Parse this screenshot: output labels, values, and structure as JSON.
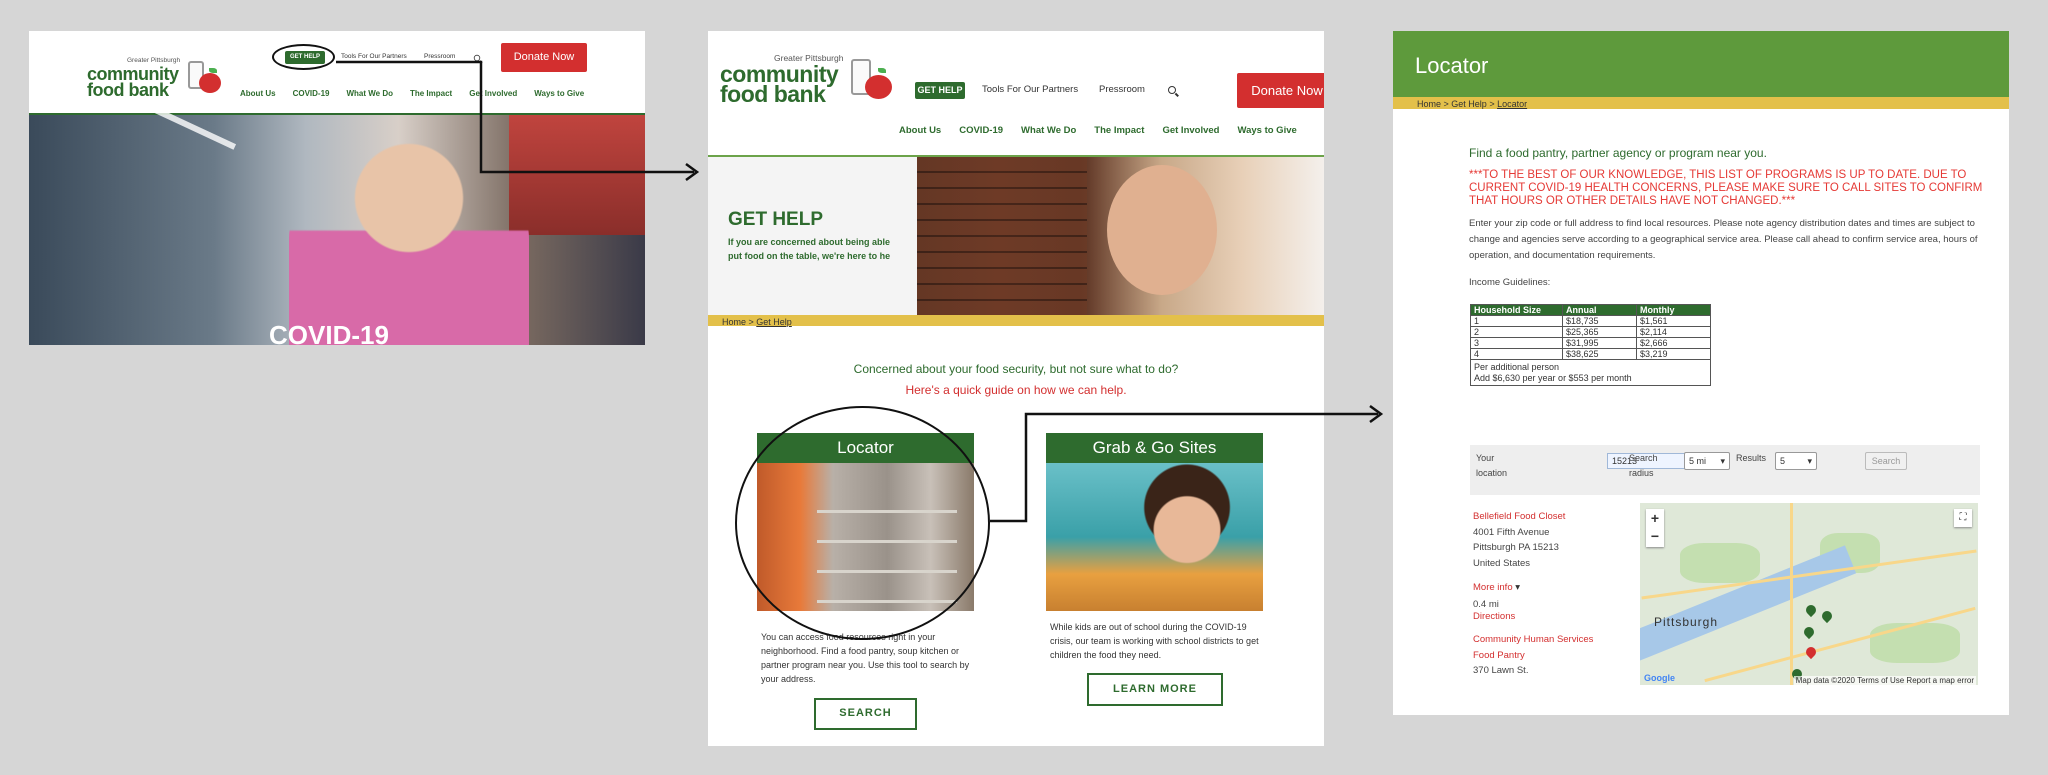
{
  "site": {
    "logo_pre": "Greater Pittsburgh",
    "logo_line1": "community",
    "logo_line2": "food bank",
    "get_help": "GET HELP",
    "tools": "Tools For Our Partners",
    "pressroom": "Pressroom",
    "donate": "Donate Now",
    "nav": [
      "About Us",
      "COVID-19",
      "What We Do",
      "The Impact",
      "Get Involved",
      "Ways to Give"
    ]
  },
  "panel1": {
    "hero_caption": "COVID-19"
  },
  "panel2": {
    "title": "GET HELP",
    "subtitle_1": "If you are concerned about being able",
    "subtitle_2": "put food on the table, we're here to he",
    "crumb_home": "Home",
    "crumb_sep": " > ",
    "crumb_current": "Get Help",
    "question": "Concerned about your food security, but not sure what to do?",
    "guide": "Here's a quick guide on how we can help.",
    "card1": {
      "title": "Locator",
      "text": "You can access food resources right in your neighborhood. Find a food pantry, soup kitchen or partner program near you. Use this tool to search by your address.",
      "button": "SEARCH"
    },
    "card2": {
      "title": "Grab & Go Sites",
      "text": "While kids are out of school during the COVID-19 crisis, our team is working with school districts to get children the food they need.",
      "button": "LEARN MORE"
    }
  },
  "panel3": {
    "title": "Locator",
    "crumb_home": "Home",
    "crumb_gethelp": "Get Help",
    "crumb_current": "Locator",
    "heading": "Find a food pantry, partner agency or program near you.",
    "warning": "***TO THE BEST OF OUR KNOWLEDGE, THIS LIST OF PROGRAMS IS UP TO DATE. DUE TO CURRENT COVID-19 HEALTH CONCERNS, PLEASE MAKE SURE TO CALL SITES TO CONFIRM THAT HOURS OR OTHER DETAILS HAVE NOT CHANGED.***",
    "intro": "Enter your zip code or full address to find local resources. Please note agency distribution dates and times are subject to change and agencies serve according to a geographical service area. Please call ahead to confirm service area, hours of operation, and documentation requirements.",
    "income_label": "Income Guidelines:",
    "table_headers": [
      "Household Size",
      "Annual",
      "Monthly"
    ],
    "table_rows": [
      [
        "1",
        "$18,735",
        "$1,561"
      ],
      [
        "2",
        "$25,365",
        "$2,114"
      ],
      [
        "3",
        "$31,995",
        "$2,666"
      ],
      [
        "4",
        "$38,625",
        "$3,219"
      ]
    ],
    "table_extra_1": "Per additional person",
    "table_extra_2": "Add $6,630 per year or $553 per month",
    "search": {
      "location_label_1": "Your",
      "location_label_2": "location",
      "zip_value": "15213",
      "radius_label_1": "Search",
      "radius_label_2": "radius",
      "radius_value": "5 mi",
      "results_label": "Results",
      "results_value": "5",
      "button": "Search"
    },
    "result1": {
      "name": "Bellefield Food Closet",
      "address1": "4001 Fifth Avenue",
      "address2": "Pittsburgh PA 15213",
      "country": "United States",
      "more_info": "More info",
      "distance": "0.4 mi",
      "directions": "Directions"
    },
    "result2": {
      "name_1": "Community Human Services",
      "name_2": "Food Pantry",
      "address1": "370 Lawn St."
    },
    "map": {
      "city": "Pittsburgh",
      "attribution": "Map data ©2020   Terms of Use   Report a map error",
      "google": "Google",
      "zoom_in": "+",
      "zoom_out": "−"
    }
  },
  "colors": {
    "green": "#2e6b2e",
    "light_green": "#5e9a3c",
    "red": "#d32f2f",
    "yellow": "#e3c04a"
  }
}
